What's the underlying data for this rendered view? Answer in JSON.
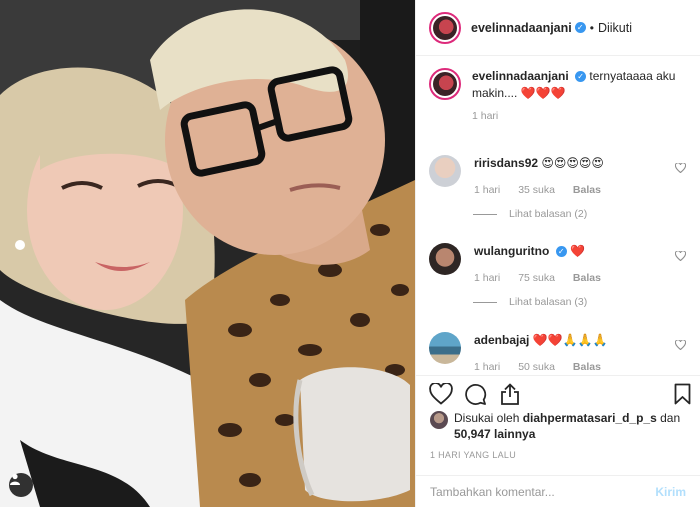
{
  "header": {
    "username": "evelinnadaanjani",
    "verified": true,
    "separator": "•",
    "follow_status": "Diikuti"
  },
  "caption": {
    "username": "evelinnadaanjani",
    "text": "ternyataaaa aku makin.... ❤️❤️❤️",
    "time": "1 hari"
  },
  "comments": [
    {
      "username": "ririsdans92",
      "text": "😍😍😍😍😍",
      "time": "1 hari",
      "likes": "35 suka",
      "reply_label": "Balas",
      "view_replies": "Lihat balasan (2)"
    },
    {
      "username": "wulanguritno",
      "verified": true,
      "text": "❤️",
      "time": "1 hari",
      "likes": "75 suka",
      "reply_label": "Balas",
      "view_replies": "Lihat balasan (3)"
    },
    {
      "username": "adenbajaj",
      "text": "❤️❤️🙏🙏🙏",
      "time": "1 hari",
      "likes": "50 suka",
      "reply_label": "Balas"
    }
  ],
  "actions": {
    "icons": [
      "heart-icon",
      "comment-icon",
      "share-icon",
      "bookmark-icon"
    ]
  },
  "likes": {
    "prefix": "Disukai oleh",
    "user": "diahpermatasari_d_p_s",
    "conjunction": "dan",
    "others": "50,947 lainnya"
  },
  "timestamp": "1 hari yang lalu",
  "comment_input": {
    "placeholder": "Tambahkan komentar...",
    "post_label": "Kirim"
  },
  "colors": {
    "verified": "#3897f0",
    "heart": "#ed4956",
    "post_button_disabled": "#b2dffc",
    "muted": "#999999"
  }
}
